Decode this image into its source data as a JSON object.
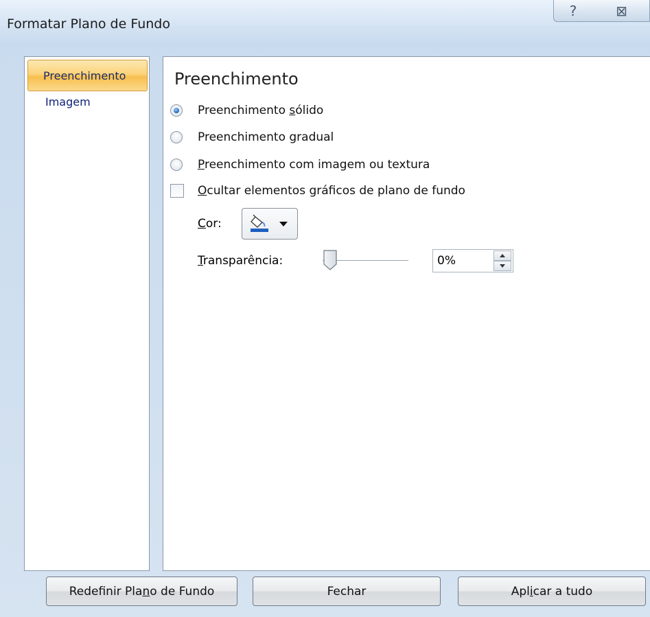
{
  "window": {
    "title": "Formatar Plano de Fundo",
    "help_label": "?",
    "close_label": "⊠"
  },
  "sidebar": {
    "items": [
      {
        "label": "Preenchimento",
        "selected": true
      },
      {
        "label": "Imagem",
        "selected": false
      }
    ]
  },
  "main": {
    "section_title": "Preenchimento",
    "fill_options": [
      {
        "label_pre": "Preenchimento ",
        "accel": "s",
        "label_post": "ólido",
        "checked": true
      },
      {
        "label_pre": "Preenchimento ",
        "accel": "g",
        "label_post": "radual",
        "checked": false
      },
      {
        "label_pre": "",
        "accel": "P",
        "label_post": "reenchimento com imagem ou textura",
        "checked": false
      }
    ],
    "hide_graphics": {
      "accel": "O",
      "label_post": "cultar elementos gráficos de plano de fundo",
      "checked": false
    },
    "color": {
      "accel": "C",
      "label_post": "or:",
      "icon": "paint-bucket-icon",
      "swatch": "#1f5fbf"
    },
    "transparency": {
      "accel": "T",
      "label_post": "ransparência:",
      "value_text": "0%",
      "value": 0
    }
  },
  "footer": {
    "reset": {
      "pre": "Redefinir Pla",
      "accel": "n",
      "post": "o de Fundo"
    },
    "close": {
      "pre": "Fechar",
      "accel": "",
      "post": ""
    },
    "apply": {
      "pre": "Apl",
      "accel": "i",
      "post": "car a tudo"
    }
  }
}
